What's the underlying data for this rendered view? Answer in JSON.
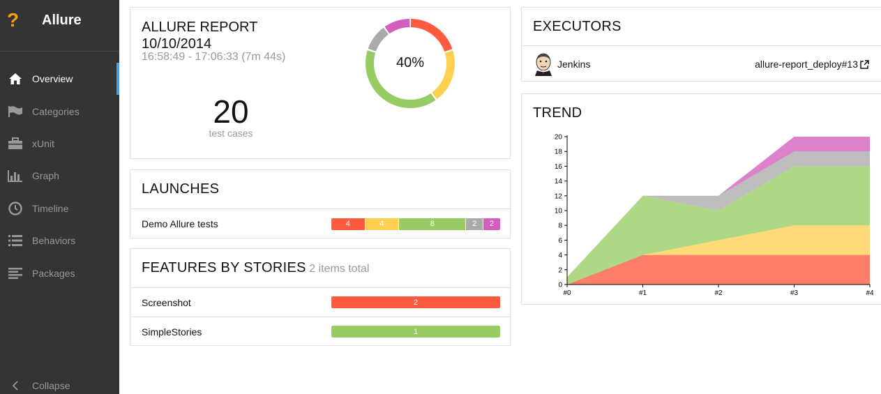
{
  "sidebar": {
    "logo": "?",
    "brand": "Allure",
    "items": [
      {
        "label": "Overview",
        "icon": "home-icon",
        "active": true
      },
      {
        "label": "Categories",
        "icon": "flag-icon",
        "active": false
      },
      {
        "label": "xUnit",
        "icon": "briefcase-icon",
        "active": false
      },
      {
        "label": "Graph",
        "icon": "bar-chart-icon",
        "active": false
      },
      {
        "label": "Timeline",
        "icon": "clock-icon",
        "active": false
      },
      {
        "label": "Behaviors",
        "icon": "list-icon",
        "active": false
      },
      {
        "label": "Packages",
        "icon": "align-left-icon",
        "active": false
      }
    ],
    "collapse_label": "Collapse"
  },
  "summary": {
    "title_line1": "ALLURE REPORT",
    "title_line2": "10/10/2014",
    "time_range": "16:58:49 - 17:06:33 (7m 44s)",
    "count": "20",
    "count_label": "test cases",
    "percent_label": "40%"
  },
  "colors": {
    "failed": "#fd5a3e",
    "broken": "#ffd050",
    "passed": "#97cc64",
    "skipped": "#aaaaaa",
    "unknown": "#d35ebe",
    "accent": "#4a9fe0",
    "logo": "#f59d1a"
  },
  "launches": {
    "title": "LAUNCHES",
    "rows": [
      {
        "name": "Demo Allure tests",
        "counts": {
          "failed": 4,
          "broken": 4,
          "passed": 8,
          "skipped": 2,
          "unknown": 2
        }
      }
    ]
  },
  "features": {
    "title": "FEATURES BY STORIES",
    "subtitle": "2 items total",
    "rows": [
      {
        "name": "Screenshot",
        "value": "2",
        "status": "failed"
      },
      {
        "name": "SimpleStories",
        "value": "1",
        "status": "passed"
      }
    ]
  },
  "executors": {
    "title": "EXECUTORS",
    "name": "Jenkins",
    "link": "allure-report_deploy#13",
    "icon": "jenkins-icon",
    "link_icon": "external-link-icon"
  },
  "trend": {
    "title": "TREND"
  },
  "chart_data": {
    "type": "area",
    "stacked": true,
    "categories": [
      "#0",
      "#1",
      "#2",
      "#3",
      "#4"
    ],
    "ylim": [
      0,
      20
    ],
    "yticks": [
      0,
      2,
      4,
      6,
      8,
      10,
      12,
      14,
      16,
      18,
      20
    ],
    "series": [
      {
        "name": "failed",
        "values": [
          0,
          4,
          4,
          4,
          4
        ]
      },
      {
        "name": "broken",
        "values": [
          0,
          0,
          2,
          4,
          4
        ]
      },
      {
        "name": "passed",
        "values": [
          1,
          8,
          4,
          8,
          8
        ]
      },
      {
        "name": "skipped",
        "values": [
          0,
          0,
          2,
          2,
          2
        ]
      },
      {
        "name": "unknown",
        "values": [
          0,
          0,
          0,
          2,
          2
        ]
      }
    ],
    "grid": false,
    "legend": "none"
  }
}
